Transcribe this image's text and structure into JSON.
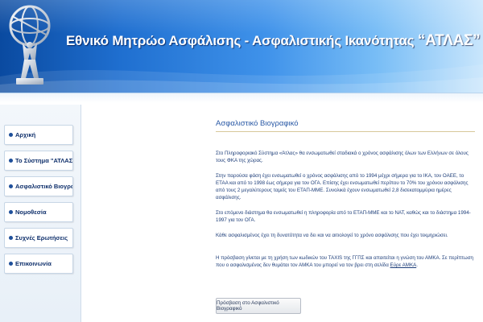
{
  "header": {
    "title_main": "Εθνικό Μητρώο Ασφάλισης - Ασφαλιστικής Ικανότητας ",
    "title_brand": "“ΑΤΛΑΣ”"
  },
  "sidebar": {
    "items": [
      {
        "label": "Αρχική"
      },
      {
        "label": "Το Σύστημα \"ΑΤΛΑΣ\""
      },
      {
        "label": "Ασφαλιστικό Βιογραφικό"
      },
      {
        "label": "Νομοθεσία"
      },
      {
        "label": "Συχνές Ερωτήσεις"
      },
      {
        "label": "Επικοινωνία"
      }
    ]
  },
  "main": {
    "title": "Ασφαλιστικό Βιογραφικό",
    "paragraphs": [
      "Στο Πληροφοριακό Σύστημα «Άτλας» θα ενσωματωθεί σταδιακά ο χρόνος ασφάλισης όλων των Ελλήνων σε όλους τους ΦΚΑ της χώρας.",
      "Στην παρούσα φάση έχει ενσωματωθεί ο χρόνος ασφάλισης από το 1994 μέχρι σήμερα για το ΙΚΑ, τον ΟΑΕΕ, το ΕΤΑΑ και από το 1998 έως σήμερα για τον ΟΓΑ. Επίσης έχει ενσωματωθεί περίπου το 70% του χρόνου ασφάλισης από τους 2 μεγαλύτερους ταμείς του ΕΤΑΠ-ΜΜΕ. Συνολικά έχουν ενσωματωθεί 2,8 δισεκατομμύρια ημέρες ασφάλισης.",
      "Στο επόμενο διάστημα θα ενσωματωθεί η πληροφορία από το ΕΤΑΠ-ΜΜΕ και το ΝΑΤ, καθώς και το διάστημα 1994-1997 για τον ΟΓΑ.",
      "Κάθε ασφαλισμένος έχει τη δυνατότητα να δει και να αιτιολογεί το χρόνο ασφάλισης που έχει τεκμηριώσει."
    ],
    "last_paragraph_text": "Η πρόσβαση γίνεται με τη χρήση των κωδικών του TAXIS της ΓΓΠΣ και απαιτείται η γνώση του ΑΜΚΑ. Σε περίπτωση που ο ασφαλισμένος δεν θυμάται τον ΑΜΚΑ του μπορεί να τον βρει στη σελίδα ",
    "last_paragraph_link": "Εύρε ΑΜΚΑ",
    "last_paragraph_end": ".",
    "action_button": "Πρόσβαση στο Ασφαλιστικό Βιογραφικό"
  },
  "colors": {
    "header_dark": "#0a4aa0",
    "header_light": "#c9e6fc",
    "nav_text": "#0e2f6b",
    "title_blue": "#2b5aa6",
    "body_text": "#1f3f7a"
  },
  "icons": {
    "logo": "atlas-globe-logo-icon",
    "nav_bullet": "bullet-icon"
  }
}
